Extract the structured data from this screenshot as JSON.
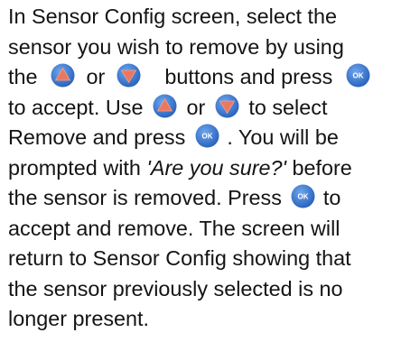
{
  "colors": {
    "up_button": "#3d7ed9",
    "down_button": "#3d7ed9",
    "ok_button": "#3d7ed9",
    "arrow_fill": "#e97860",
    "ok_text": "#ffffff",
    "body_text": "#141414"
  },
  "icons": {
    "up": "up-arrow-button-icon",
    "down": "down-arrow-button-icon",
    "ok": "ok-button-icon"
  },
  "ok_label": "OK",
  "text": {
    "l1": "In Sensor Config screen, select the",
    "l2": "sensor you wish to remove by using",
    "l3a": "the",
    "l3b": "or",
    "l3c": "buttons and press",
    "l4a": "to accept. Use",
    "l4b": "or",
    "l4c": "to select",
    "l5a": "Remove and press",
    "l5b": ". You will be",
    "l6a": "prompted with",
    "l6b": "'Are you sure?'",
    "l6c": "before",
    "l7a": "the sensor is removed. Press",
    "l7b": "to",
    "l8": "accept and remove. The screen will",
    "l9": "return to Sensor Config showing that",
    "l10": "the sensor previously selected is no",
    "l11": "longer present."
  }
}
